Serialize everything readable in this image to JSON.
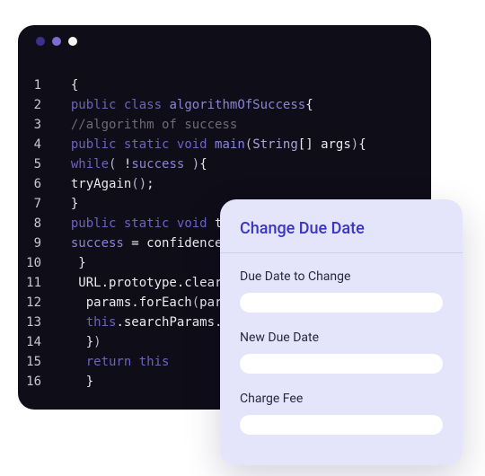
{
  "window": {
    "dot_colors": [
      "#3b2f8f",
      "#7a6fcf",
      "#f5f5f5"
    ]
  },
  "code": {
    "lines": [
      {
        "n": "1",
        "segs": [
          [
            "",
            "  {"
          ]
        ]
      },
      {
        "n": "2",
        "segs": [
          [
            "",
            "  "
          ],
          [
            "kw",
            "public"
          ],
          [
            "",
            " "
          ],
          [
            "kw",
            "class"
          ],
          [
            "",
            " "
          ],
          [
            "type",
            "algorithmOfSuccess"
          ],
          [
            "",
            "{"
          ]
        ]
      },
      {
        "n": "3",
        "segs": [
          [
            "",
            "  "
          ],
          [
            "comment",
            "//algorithm of success"
          ]
        ]
      },
      {
        "n": "4",
        "segs": [
          [
            "",
            "  "
          ],
          [
            "kw",
            "public"
          ],
          [
            "",
            " "
          ],
          [
            "kw",
            "static"
          ],
          [
            "",
            " "
          ],
          [
            "kw",
            "void"
          ],
          [
            "",
            " "
          ],
          [
            "type",
            "main"
          ],
          [
            "paren",
            "("
          ],
          [
            "str",
            "String"
          ],
          [
            "",
            "[] args"
          ],
          [
            "paren",
            ")"
          ],
          [
            "",
            "{"
          ]
        ]
      },
      {
        "n": "5",
        "segs": [
          [
            "",
            "  "
          ],
          [
            "kw",
            "while"
          ],
          [
            "paren",
            "("
          ],
          [
            "",
            " !"
          ],
          [
            "type",
            "success"
          ],
          [
            "",
            " "
          ],
          [
            "paren",
            ")"
          ],
          [
            "",
            "{"
          ]
        ]
      },
      {
        "n": "6",
        "segs": [
          [
            "",
            "  tryAgain"
          ],
          [
            "paren",
            "()"
          ],
          [
            "",
            ";"
          ]
        ]
      },
      {
        "n": "7",
        "segs": [
          [
            "",
            "  }"
          ]
        ]
      },
      {
        "n": "8",
        "segs": [
          [
            "",
            "  "
          ],
          [
            "kw",
            "public"
          ],
          [
            "",
            " "
          ],
          [
            "kw",
            "static"
          ],
          [
            "",
            " "
          ],
          [
            "kw",
            "void"
          ],
          [
            "",
            " tr"
          ]
        ]
      },
      {
        "n": "9",
        "segs": [
          [
            "",
            "  "
          ],
          [
            "type",
            "success"
          ],
          [
            "",
            " = confidence "
          ]
        ]
      },
      {
        "n": "10",
        "segs": [
          [
            "",
            "   }"
          ]
        ]
      },
      {
        "n": "11",
        "segs": [
          [
            "",
            "   URL.prototype.clear "
          ]
        ]
      },
      {
        "n": "12",
        "segs": [
          [
            "",
            "    params.forEach"
          ],
          [
            "paren",
            "("
          ],
          [
            "",
            "param"
          ]
        ]
      },
      {
        "n": "13",
        "segs": [
          [
            "",
            "    "
          ],
          [
            "kw",
            "this"
          ],
          [
            "",
            ".searchParams.de"
          ]
        ]
      },
      {
        "n": "14",
        "segs": [
          [
            "",
            "    }"
          ],
          [
            "paren",
            ")"
          ]
        ]
      },
      {
        "n": "15",
        "segs": [
          [
            "",
            "    "
          ],
          [
            "kw",
            "return"
          ],
          [
            "",
            " "
          ],
          [
            "kw",
            "this"
          ]
        ]
      },
      {
        "n": "16",
        "segs": [
          [
            "",
            "    }"
          ]
        ]
      }
    ]
  },
  "form": {
    "title": "Change Due Date",
    "fields": [
      {
        "label": "Due Date to Change"
      },
      {
        "label": "New Due Date"
      },
      {
        "label": "Charge Fee"
      }
    ]
  }
}
